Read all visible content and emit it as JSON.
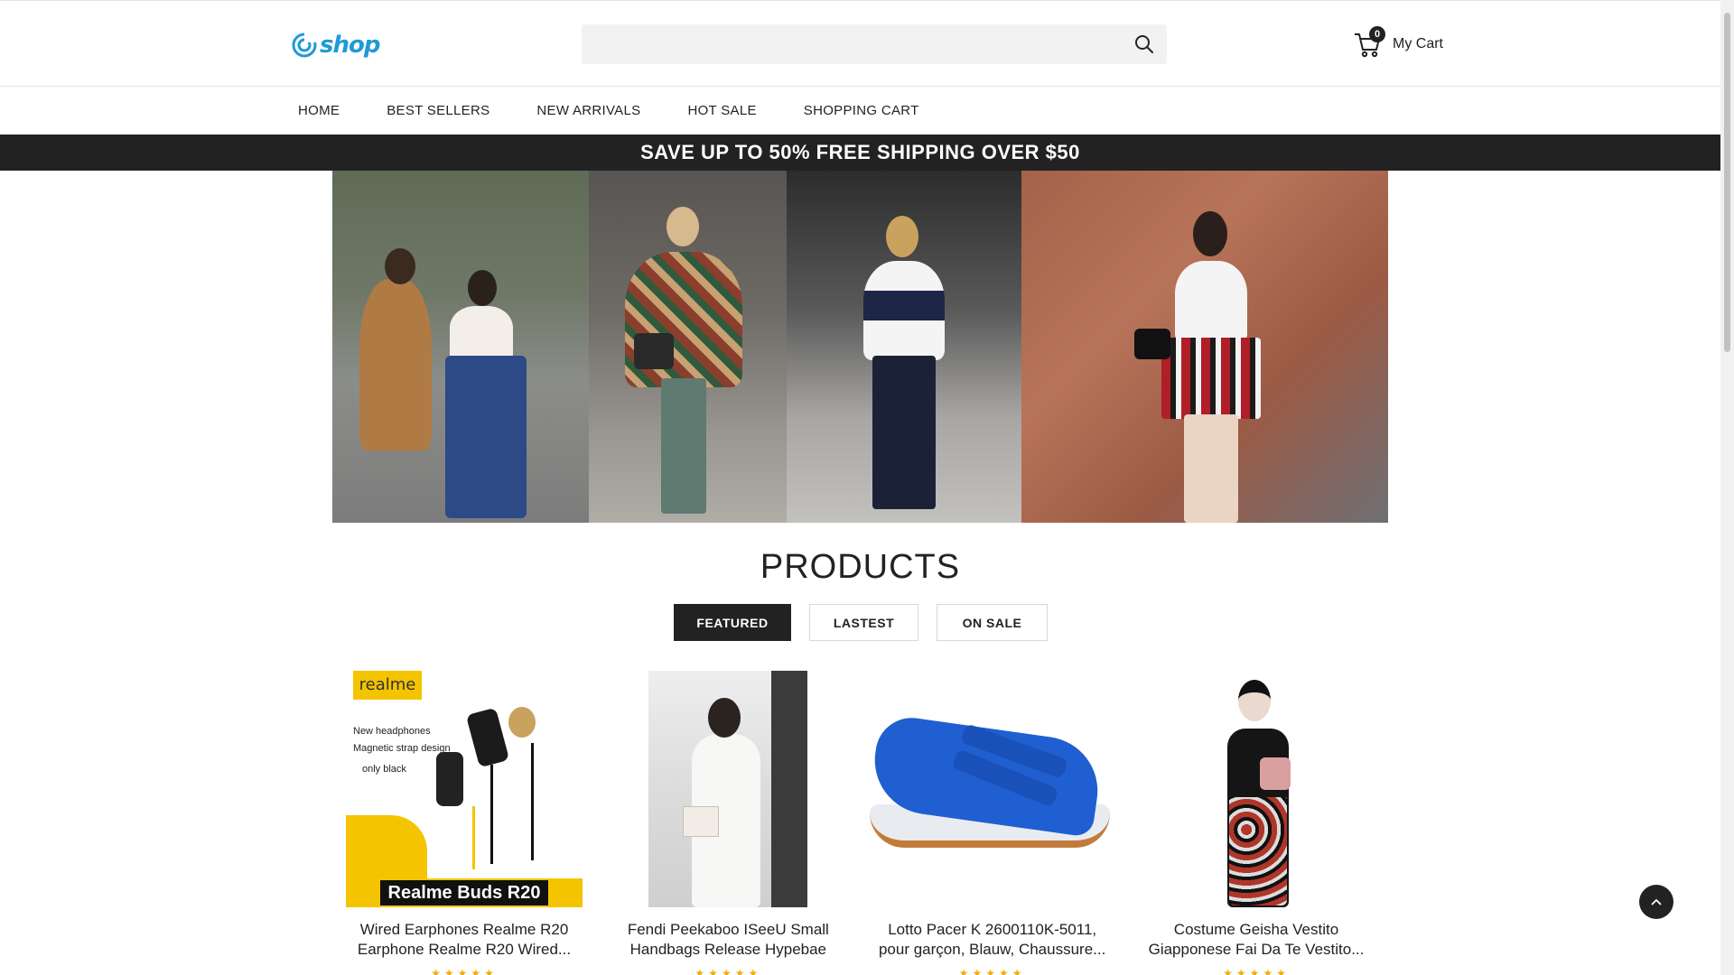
{
  "header": {
    "logo_text": "shop",
    "search": {
      "placeholder": "",
      "value": ""
    },
    "cart": {
      "count": "0",
      "label": "My Cart"
    }
  },
  "nav": {
    "items": [
      {
        "label": "HOME"
      },
      {
        "label": "BEST SELLERS"
      },
      {
        "label": "NEW ARRIVALS"
      },
      {
        "label": "HOT SALE"
      },
      {
        "label": "SHOPPING CART"
      }
    ]
  },
  "promo": {
    "text": "SAVE UP TO 50% FREE SHIPPING OVER $50"
  },
  "products": {
    "title": "PRODUCTS",
    "tabs": [
      {
        "label": "FEATURED",
        "active": true
      },
      {
        "label": "LASTEST",
        "active": false
      },
      {
        "label": "ON SALE",
        "active": false
      }
    ],
    "items": [
      {
        "name": "Wired Earphones Realme R20 Earphone Realme R20 Wired...",
        "image": {
          "brand": "realme",
          "copy_line1": "New headphones",
          "copy_line2": "Magnetic strap design",
          "copy_line3": "only black",
          "label": "Realme Buds R20"
        },
        "rating": "★★★★★"
      },
      {
        "name": "Fendi Peekaboo ISeeU Small Handbags Release Hypebae",
        "rating": "★★★★★"
      },
      {
        "name": "Lotto Pacer K 2600110K-5011, pour garçon, Blauw, Chaussure...",
        "rating": "★★★★★"
      },
      {
        "name": "Costume Geisha Vestito Giapponese Fai Da Te Vestito...",
        "rating": "★★★★★"
      }
    ]
  },
  "colors": {
    "brand": "#1f9ad6",
    "dark": "#222222",
    "accent_yellow": "#f5c400"
  }
}
